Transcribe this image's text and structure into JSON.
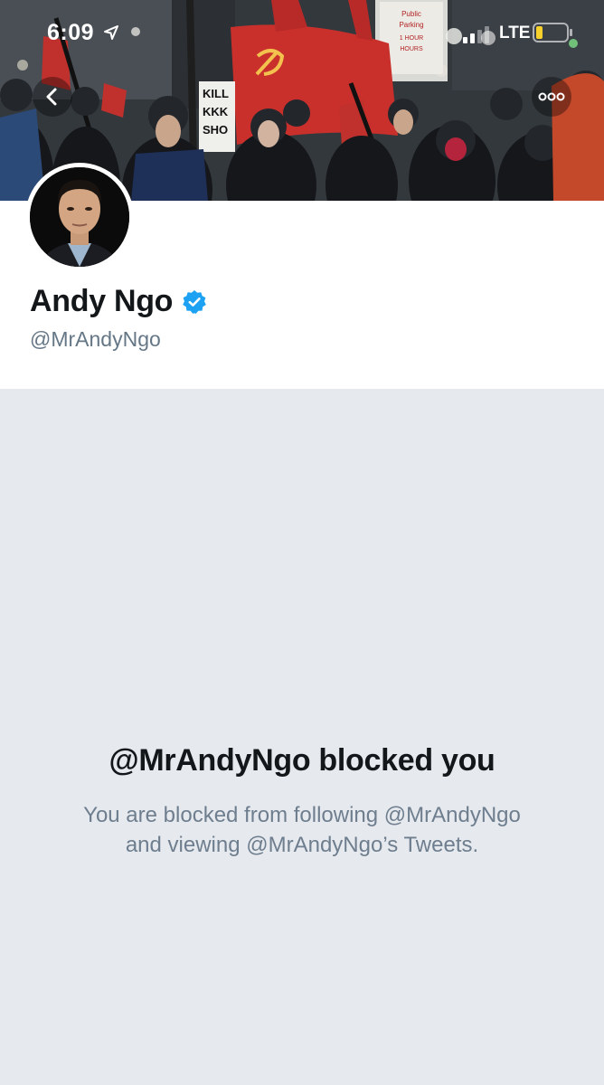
{
  "status_bar": {
    "time": "6:09",
    "carrier": "LTE",
    "location_icon": "location-arrow-icon",
    "signal_icon": "cellular-signal-icon",
    "battery_icon": "battery-low-icon"
  },
  "navigation": {
    "back_icon": "chevron-left-icon",
    "more_icon": "more-horizontal-icon"
  },
  "banner": {
    "sign_text": [
      "KILL",
      "KKK",
      "SHO"
    ],
    "store_sign": [
      "Public",
      "Parking",
      "1 HOUR",
      "HOURS"
    ]
  },
  "profile": {
    "display_name": "Andy Ngo",
    "handle": "@MrAndyNgo",
    "verified": true,
    "verified_icon": "verified-badge-icon"
  },
  "blocked": {
    "title": "@MrAndyNgo blocked you",
    "description_line1": "You are blocked from following @MrAndyNgo",
    "description_line2": "and viewing @MrAndyNgo’s Tweets."
  },
  "colors": {
    "verified_blue": "#1da1f2",
    "background_gray": "#e6e9ee",
    "text_primary": "#14171a",
    "text_secondary": "#657786",
    "flag_red": "#c9302c"
  }
}
